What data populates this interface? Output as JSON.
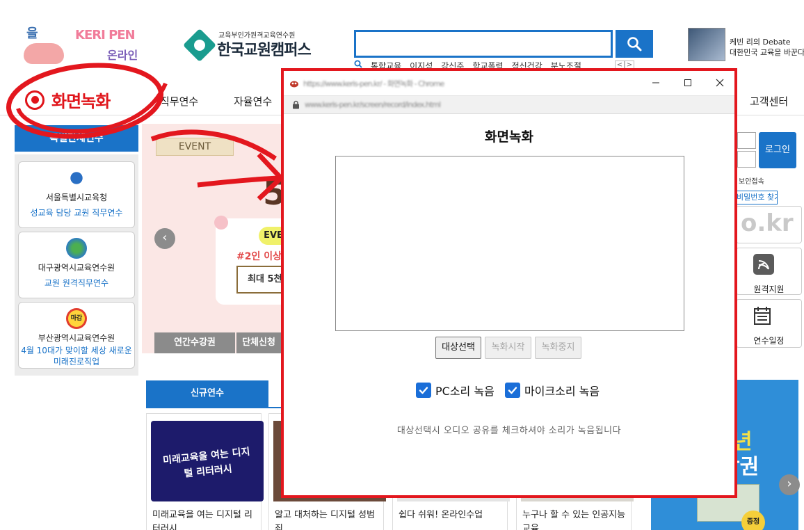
{
  "header": {
    "logo_left_text": "을",
    "logo_keris_text": "KERI PEN",
    "logo_online_text": "온라인",
    "logo_main_sub": "교육부인가원격교육연수원",
    "logo_main_name": "한국교원캠퍼스",
    "search": {
      "placeholder": "",
      "button_icon": "search-icon"
    },
    "keywords": [
      "통합교육",
      "이지성",
      "강신주",
      "학교폭력",
      "정신건강",
      "분노조절"
    ],
    "keyword_prev": "<",
    "keyword_next": ">",
    "debate_line1": "케빈 리의 Debate",
    "debate_line2": "대한민국 교육을 바꾼다"
  },
  "nav": {
    "record_label": "화면녹화",
    "items": [
      "직무연수",
      "자율연수"
    ],
    "cs": "고객센터"
  },
  "left": {
    "tab_label": "특별단체연수",
    "cards": [
      {
        "name": "서울특별시교육청",
        "desc": "성교육 담당 교원 직무연수"
      },
      {
        "name": "대구광역시교육연수원",
        "desc": "교원 원격직무연수"
      },
      {
        "name": "부산광역시교육연수원",
        "desc": "4월 10대가 맞이할 세상 새로운 미래진로직업",
        "badge": "마감"
      }
    ]
  },
  "banner": {
    "event": "EVENT",
    "big_text": "5",
    "ev_badge": "EVE",
    "promo": "#2인 이상",
    "box": "최대 5천",
    "prev": "‹",
    "tabs": [
      "연간수강권",
      "단체신청"
    ]
  },
  "right": {
    "login_label": "로그인",
    "secure_label": "보안접속",
    "find_pw": "비밀번호 찾기",
    "domain": "o.kr",
    "remote": "원격지원",
    "schedule": "연수일정"
  },
  "lower": {
    "new_tab": "신규연수",
    "courses": [
      {
        "title": "미래교육을 여는 디지털 리터러시",
        "thumb_text": "미래교육을 여는 디지털 리터러시"
      },
      {
        "title": "알고 대처하는 디지털 성범죄"
      },
      {
        "title": "쉽다 쉬워! 온라인수업"
      },
      {
        "title": "누구나 할 수 있는 인공지능 교육"
      }
    ],
    "promo_t1": "년",
    "promo_t2": "강권",
    "promo_badge": "증정",
    "next": "›"
  },
  "popup": {
    "title_blurred": "https://www.keris-pen.kr/ - 화면녹화 - Chrome",
    "address_blurred": "www.keris-pen.kr/screen/record/index.html",
    "heading": "화면녹화",
    "btn_select": "대상선택",
    "btn_start": "녹화시작",
    "btn_stop": "녹화중지",
    "chk_pc": "PC소리 녹음",
    "chk_mic": "마이크소리 녹음",
    "chk_pc_checked": true,
    "chk_mic_checked": true,
    "hint": "대상선택시 오디오 공유를 체크하셔야 소리가 녹음됩니다"
  },
  "colors": {
    "brand_blue": "#1a73c8",
    "annotation_red": "#e3171e",
    "checkbox_blue": "#1a6ed8"
  }
}
